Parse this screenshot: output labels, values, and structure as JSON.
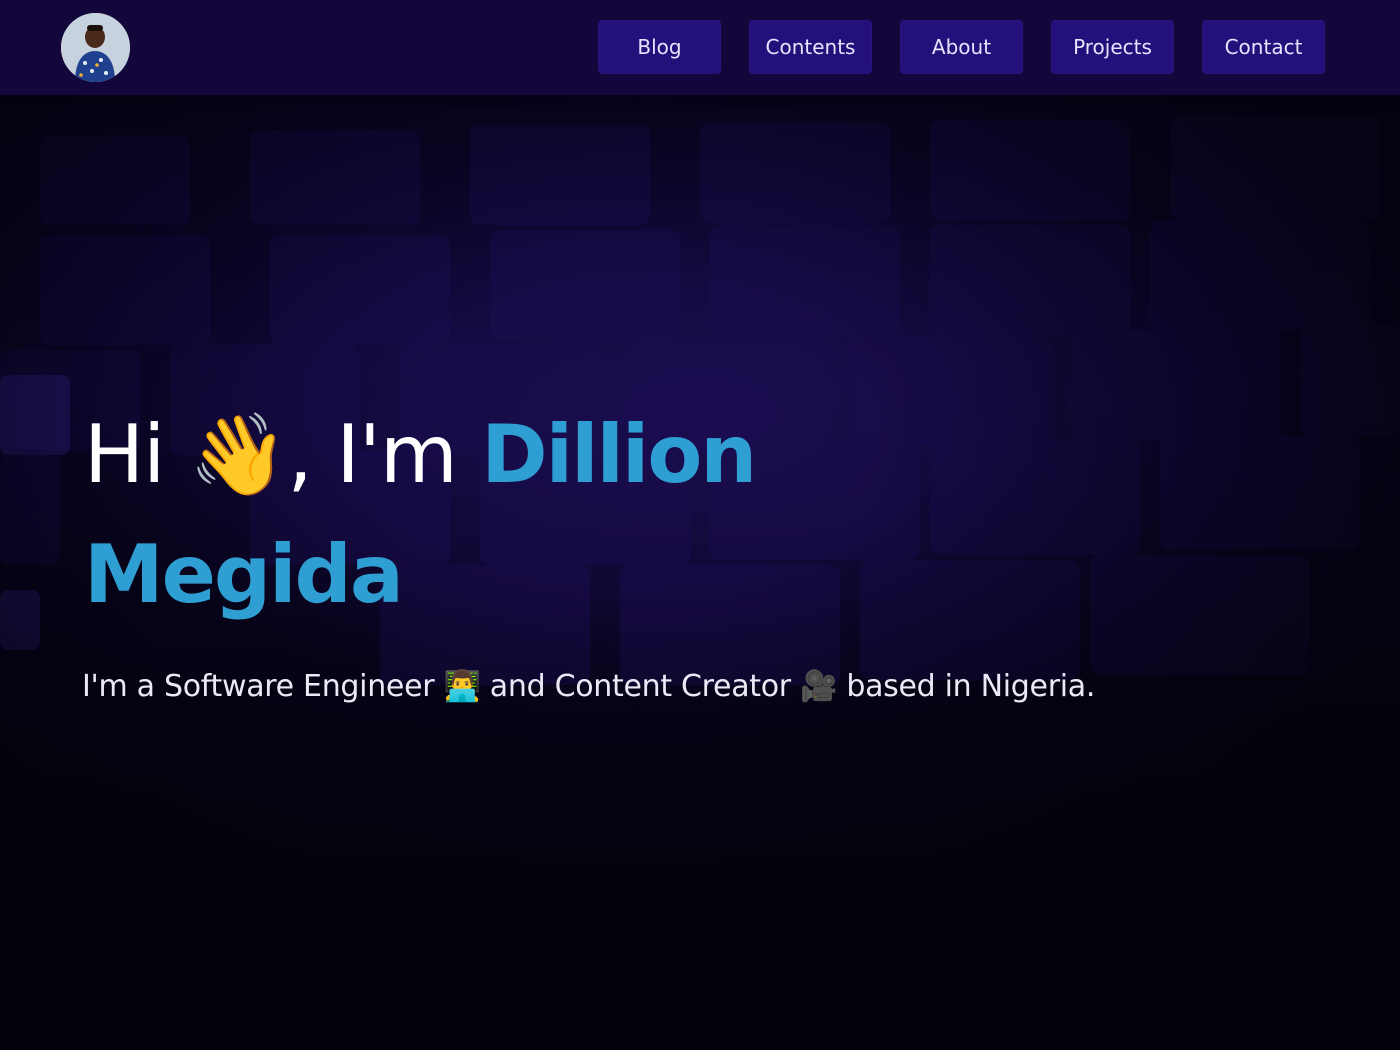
{
  "profile": {
    "avatar_alt": "Dillion Megida avatar"
  },
  "nav": {
    "items": [
      {
        "label": "Blog"
      },
      {
        "label": "Contents"
      },
      {
        "label": "About"
      },
      {
        "label": "Projects"
      },
      {
        "label": "Contact"
      }
    ]
  },
  "hero": {
    "greeting": "Hi 👋, I'm ",
    "name_first": "Dillion",
    "name_last": "Megida",
    "tagline": "I'm a Software Engineer 👨‍💻 and Content Creator 🎥 based in Nigeria."
  },
  "colors": {
    "nav_bg": "#13063a",
    "nav_button": "#24107a",
    "accent": "#2f9fd3",
    "text": "#ffffff"
  }
}
